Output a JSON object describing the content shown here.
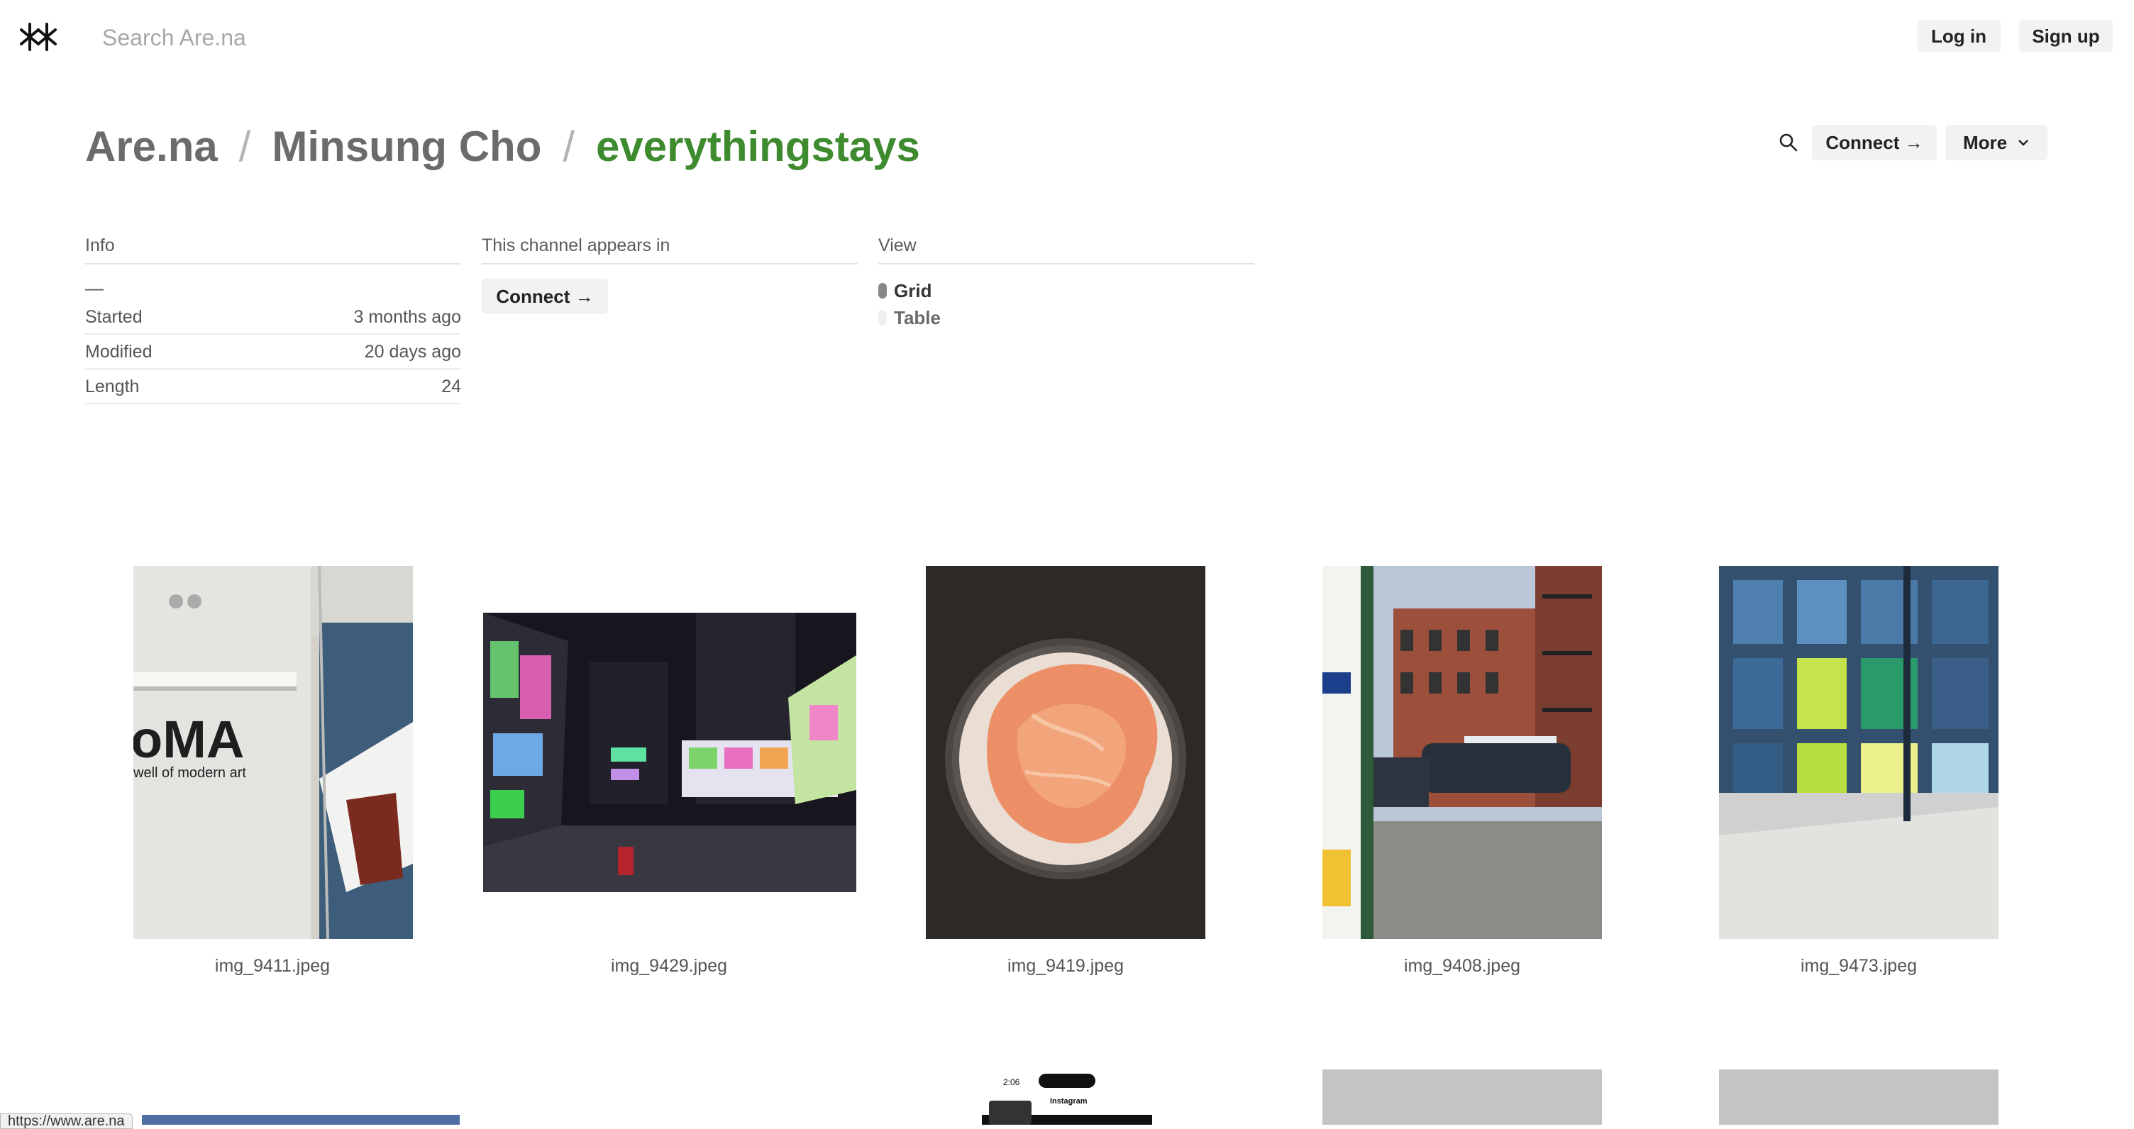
{
  "header": {
    "search_placeholder": "Search Are.na",
    "login_label": "Log in",
    "signup_label": "Sign up"
  },
  "breadcrumb": {
    "root": "Are.na",
    "owner": "Minsung Cho",
    "channel": "everythingstays",
    "separator": "/"
  },
  "channel_actions": {
    "connect_label": "Connect →",
    "more_label": "More"
  },
  "info": {
    "title": "Info",
    "description": "—",
    "rows": [
      {
        "label": "Started",
        "value": "3 months ago"
      },
      {
        "label": "Modified",
        "value": "20 days ago"
      },
      {
        "label": "Length",
        "value": "24"
      }
    ]
  },
  "appears_in": {
    "title": "This channel appears in",
    "connect_label": "Connect →"
  },
  "view": {
    "title": "View",
    "options": [
      {
        "label": "Grid",
        "selected": true
      },
      {
        "label": "Table",
        "selected": false
      }
    ]
  },
  "blocks": [
    {
      "caption": "img_9411.jpeg"
    },
    {
      "caption": "img_9429.jpeg"
    },
    {
      "caption": "img_9419.jpeg"
    },
    {
      "caption": "img_9408.jpeg"
    },
    {
      "caption": "img_9473.jpeg"
    }
  ],
  "partial_blocks": {
    "phone_time": "2:06",
    "phone_app": "Instagram"
  },
  "status_bar": {
    "url": "https://www.are.na"
  },
  "colors": {
    "channel_accent": "#3e8a2f",
    "button_bg": "#f2f2f2"
  }
}
